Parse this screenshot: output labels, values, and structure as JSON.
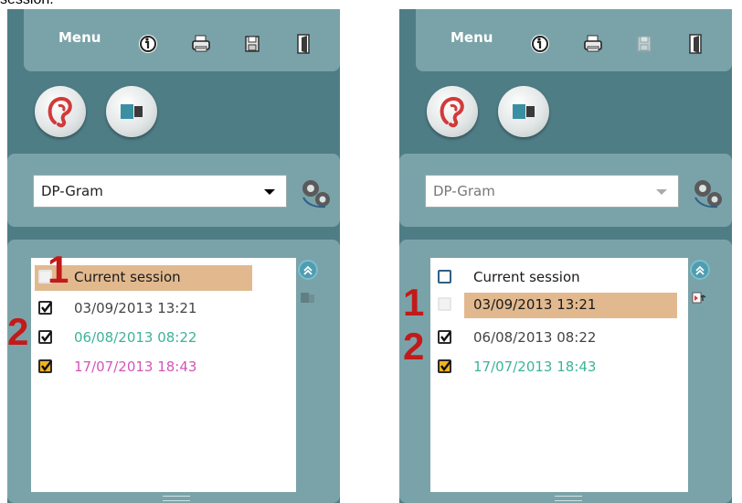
{
  "caption": "session.",
  "panels": [
    {
      "menu_label": "Menu",
      "select_value": "DP-Gram",
      "sessions": [
        {
          "label": "Current session",
          "color": "#1a1a1a",
          "check": "unchecked",
          "highlight": true
        },
        {
          "label": "03/09/2013 13:21",
          "color": "#444444",
          "check": "checked",
          "highlight": false
        },
        {
          "label": "06/08/2013 08:22",
          "color": "#3db39a",
          "check": "checked",
          "highlight": false
        },
        {
          "label": "17/07/2013 18:43",
          "color": "#d455b8",
          "check": "checked-gold",
          "highlight": false
        }
      ],
      "markers": [
        "1",
        "2"
      ]
    },
    {
      "menu_label": "Menu",
      "select_value": "DP-Gram",
      "sessions": [
        {
          "label": "Current session",
          "color": "#1a1a1a",
          "check": "unchecked",
          "highlight": false
        },
        {
          "label": "03/09/2013 13:21",
          "color": "#1a1a1a",
          "check": "unchecked",
          "highlight": true
        },
        {
          "label": "06/08/2013 08:22",
          "color": "#444444",
          "check": "checked",
          "highlight": false
        },
        {
          "label": "17/07/2013 18:43",
          "color": "#3db39a",
          "check": "checked-gold",
          "highlight": false
        }
      ],
      "markers": [
        "1",
        "2"
      ]
    }
  ],
  "icons": {
    "info": "info-icon",
    "print": "printer-icon",
    "save": "save-icon",
    "exit": "exit-door-icon",
    "ear": "ear-icon",
    "switch": "monitor-switch-icon",
    "settings": "gear-icon",
    "collapse": "double-chevron-up-icon",
    "swap": "swap-session-icon"
  },
  "colors": {
    "panel_bg": "#4f7d86",
    "section_bg": "#7aa3a9",
    "highlight": "#e2b98f",
    "marker": "#c21a1a"
  }
}
